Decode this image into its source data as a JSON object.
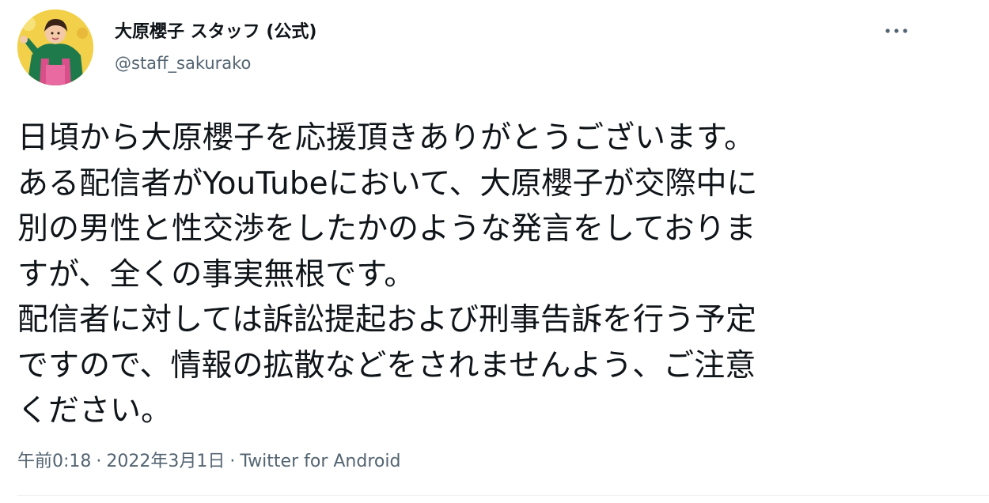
{
  "author": {
    "display_name": "大原櫻子 スタッフ (公式)",
    "handle": "@staff_sakurako",
    "avatar_icon": "profile-photo"
  },
  "more_icon": "more-horizontal-icon",
  "tweet": {
    "lines": [
      "日頃から大原櫻子を応援頂きありがとうございます。",
      "ある配信者がYouTubeにおいて、大原櫻子が交際中に",
      "別の男性と性交渉をしたかのような発言をしておりま",
      "すが、全くの事実無根です。",
      "配信者に対しては訴訟提起および刑事告訴を行う予定",
      "ですので、情報の拡散などをされませんよう、ご注意",
      "ください。"
    ]
  },
  "meta": {
    "time": "午前0:18",
    "separator": "·",
    "date": "2022年3月1日",
    "source": "Twitter for Android"
  },
  "colors": {
    "text": "#0f1419",
    "secondary": "#536471",
    "avatar_bg": "#f2d04a"
  }
}
